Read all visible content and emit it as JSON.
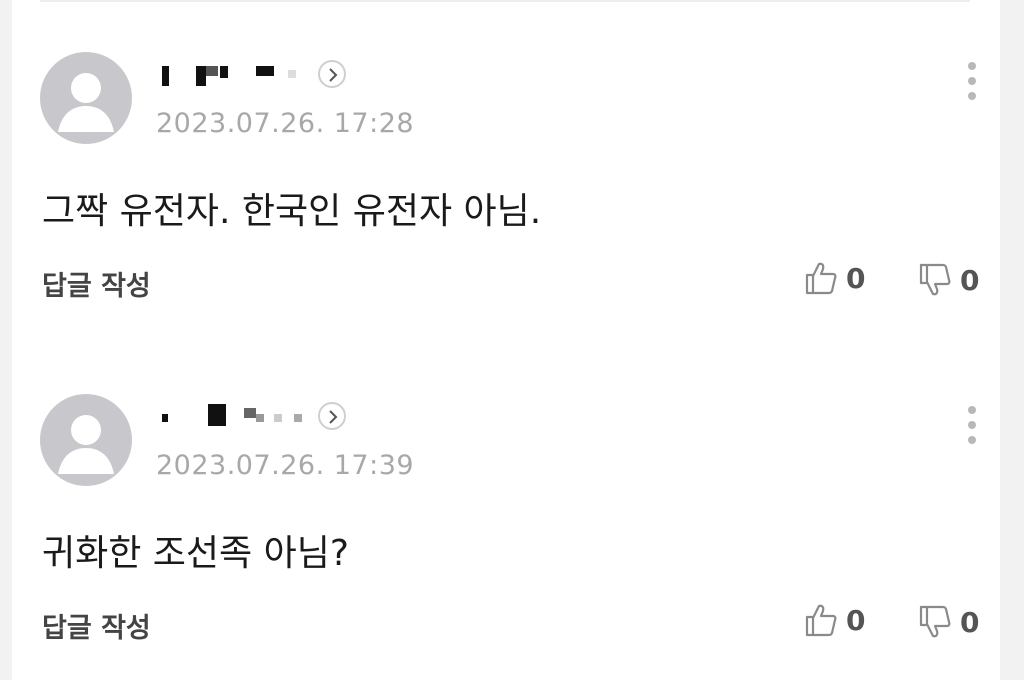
{
  "comments": [
    {
      "date": "2023.07.26. 17:28",
      "text": "그짝 유전자. 한국인 유전자 아님.",
      "reply_label": "답글 작성",
      "likes": "0",
      "dislikes": "0"
    },
    {
      "date": "2023.07.26. 17:39",
      "text": "귀화한 조선족 아님?",
      "reply_label": "답글 작성",
      "likes": "0",
      "dislikes": "0"
    }
  ],
  "colors": {
    "avatar_bg": "#c8c8cc",
    "date_text": "#a8a8a8",
    "vote_icon": "#8a8a8a"
  },
  "icons": {
    "avatar": "default-user-silhouette",
    "profile_link": "chevron-right-circle",
    "menu": "kebab-vertical",
    "like": "thumbs-up-outline",
    "dislike": "thumbs-down-outline"
  }
}
